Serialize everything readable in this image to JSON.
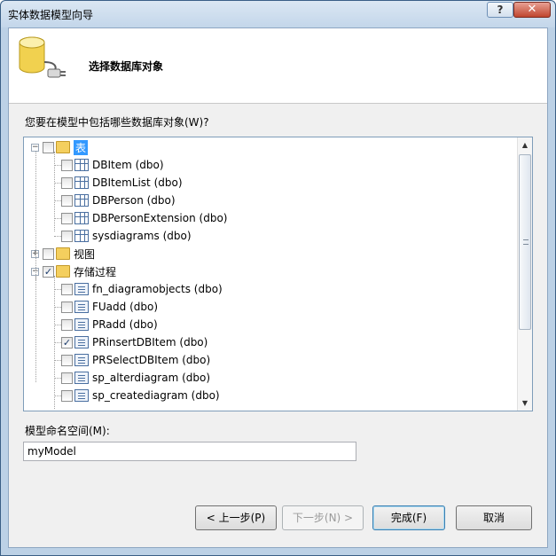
{
  "window": {
    "title": "实体数据模型向导",
    "help_label": "?",
    "close_label": "✕"
  },
  "header": {
    "title": "选择数据库对象",
    "icon": "database-plug-icon"
  },
  "prompt": "您要在模型中包括哪些数据库对象(W)?",
  "tree": {
    "nodes": [
      {
        "label": "表",
        "level": 0,
        "expander": "−",
        "checked": false,
        "icon": "folder-table-icon",
        "selected": true
      },
      {
        "label": "DBItem (dbo)",
        "level": 1,
        "checked": false,
        "icon": "table-icon"
      },
      {
        "label": "DBItemList (dbo)",
        "level": 1,
        "checked": false,
        "icon": "table-icon"
      },
      {
        "label": "DBPerson (dbo)",
        "level": 1,
        "checked": false,
        "icon": "table-icon"
      },
      {
        "label": "DBPersonExtension (dbo)",
        "level": 1,
        "checked": false,
        "icon": "table-icon"
      },
      {
        "label": "sysdiagrams (dbo)",
        "level": 1,
        "checked": false,
        "icon": "table-icon"
      },
      {
        "label": "视图",
        "level": 0,
        "expander": "+",
        "checked": false,
        "icon": "folder-view-icon"
      },
      {
        "label": "存储过程",
        "level": 0,
        "expander": "−",
        "checked": true,
        "icon": "folder-proc-icon"
      },
      {
        "label": "fn_diagramobjects (dbo)",
        "level": 1,
        "checked": false,
        "icon": "stored-procedure-icon"
      },
      {
        "label": "FUadd (dbo)",
        "level": 1,
        "checked": false,
        "icon": "stored-procedure-icon"
      },
      {
        "label": "PRadd (dbo)",
        "level": 1,
        "checked": false,
        "icon": "stored-procedure-icon"
      },
      {
        "label": "PRinsertDBItem (dbo)",
        "level": 1,
        "checked": true,
        "icon": "stored-procedure-icon"
      },
      {
        "label": "PRSelectDBItem (dbo)",
        "level": 1,
        "checked": false,
        "icon": "stored-procedure-icon"
      },
      {
        "label": "sp_alterdiagram (dbo)",
        "level": 1,
        "checked": false,
        "icon": "stored-procedure-icon"
      },
      {
        "label": "sp_creatediagram (dbo)",
        "level": 1,
        "checked": false,
        "icon": "stored-procedure-icon"
      }
    ]
  },
  "namespace": {
    "label": "模型命名空间(M):",
    "value": "myModel"
  },
  "buttons": {
    "back": "< 上一步(P)",
    "next": "下一步(N) >",
    "finish": "完成(F)",
    "cancel": "取消"
  },
  "colors": {
    "selection": "#3399ff",
    "window_frame": "#bcd1e6"
  }
}
